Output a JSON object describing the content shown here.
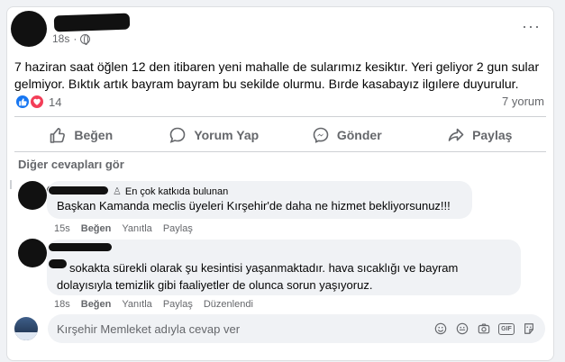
{
  "post": {
    "time": "18s",
    "text": "7 haziran saat öğlen 12 den itibaren yeni mahalle de sularımız kesiktır. Yeri geliyor 2 gun sular gelmiyor. Bıktık artık bayram bayram bu sekilde olurmu. Bırde kasabayız ilgılere duyurulur.",
    "reaction_count": "14",
    "comment_count": "7 yorum",
    "icons": {
      "globe": "globe-icon",
      "more": "more-options-icon",
      "like": "like-reaction-icon",
      "love": "love-reaction-icon"
    }
  },
  "actions": {
    "like": "Beğen",
    "comment": "Yorum Yap",
    "send": "Gönder",
    "share": "Paylaş"
  },
  "more_replies": "Diğer cevapları gör",
  "comments": [
    {
      "badge": "En çok katkıda bulunan",
      "text": "Başkan Kamanda meclis üyeleri Kırşehir'de daha ne hizmet bekliyorsunuz!!!",
      "time": "15s",
      "like": "Beğen",
      "reply": "Yanıtla",
      "share": "Paylaş"
    },
    {
      "text_line1": "sokakta sürekli olarak şu kesintisi yaşanmaktadır. hava sıcaklığı ve bayram",
      "text_line2": "dolayısıyla temizlik gibi faaliyetler de olunca sorun yaşıyoruz.",
      "time": "18s",
      "like": "Beğen",
      "reply": "Yanıtla",
      "share": "Paylaş",
      "edited": "Düzenlendi"
    }
  ],
  "reply_box": {
    "placeholder": "Kırşehir Memleket adıyla cevap ver",
    "tools": [
      "emoji-icon",
      "sticker-icon",
      "camera-icon",
      "gif-icon",
      "comment-sticker-icon"
    ]
  },
  "colors": {
    "accent": "#1877f2",
    "love": "#f33e58",
    "secondary_text": "#65676b",
    "bubble": "#f0f2f5"
  }
}
